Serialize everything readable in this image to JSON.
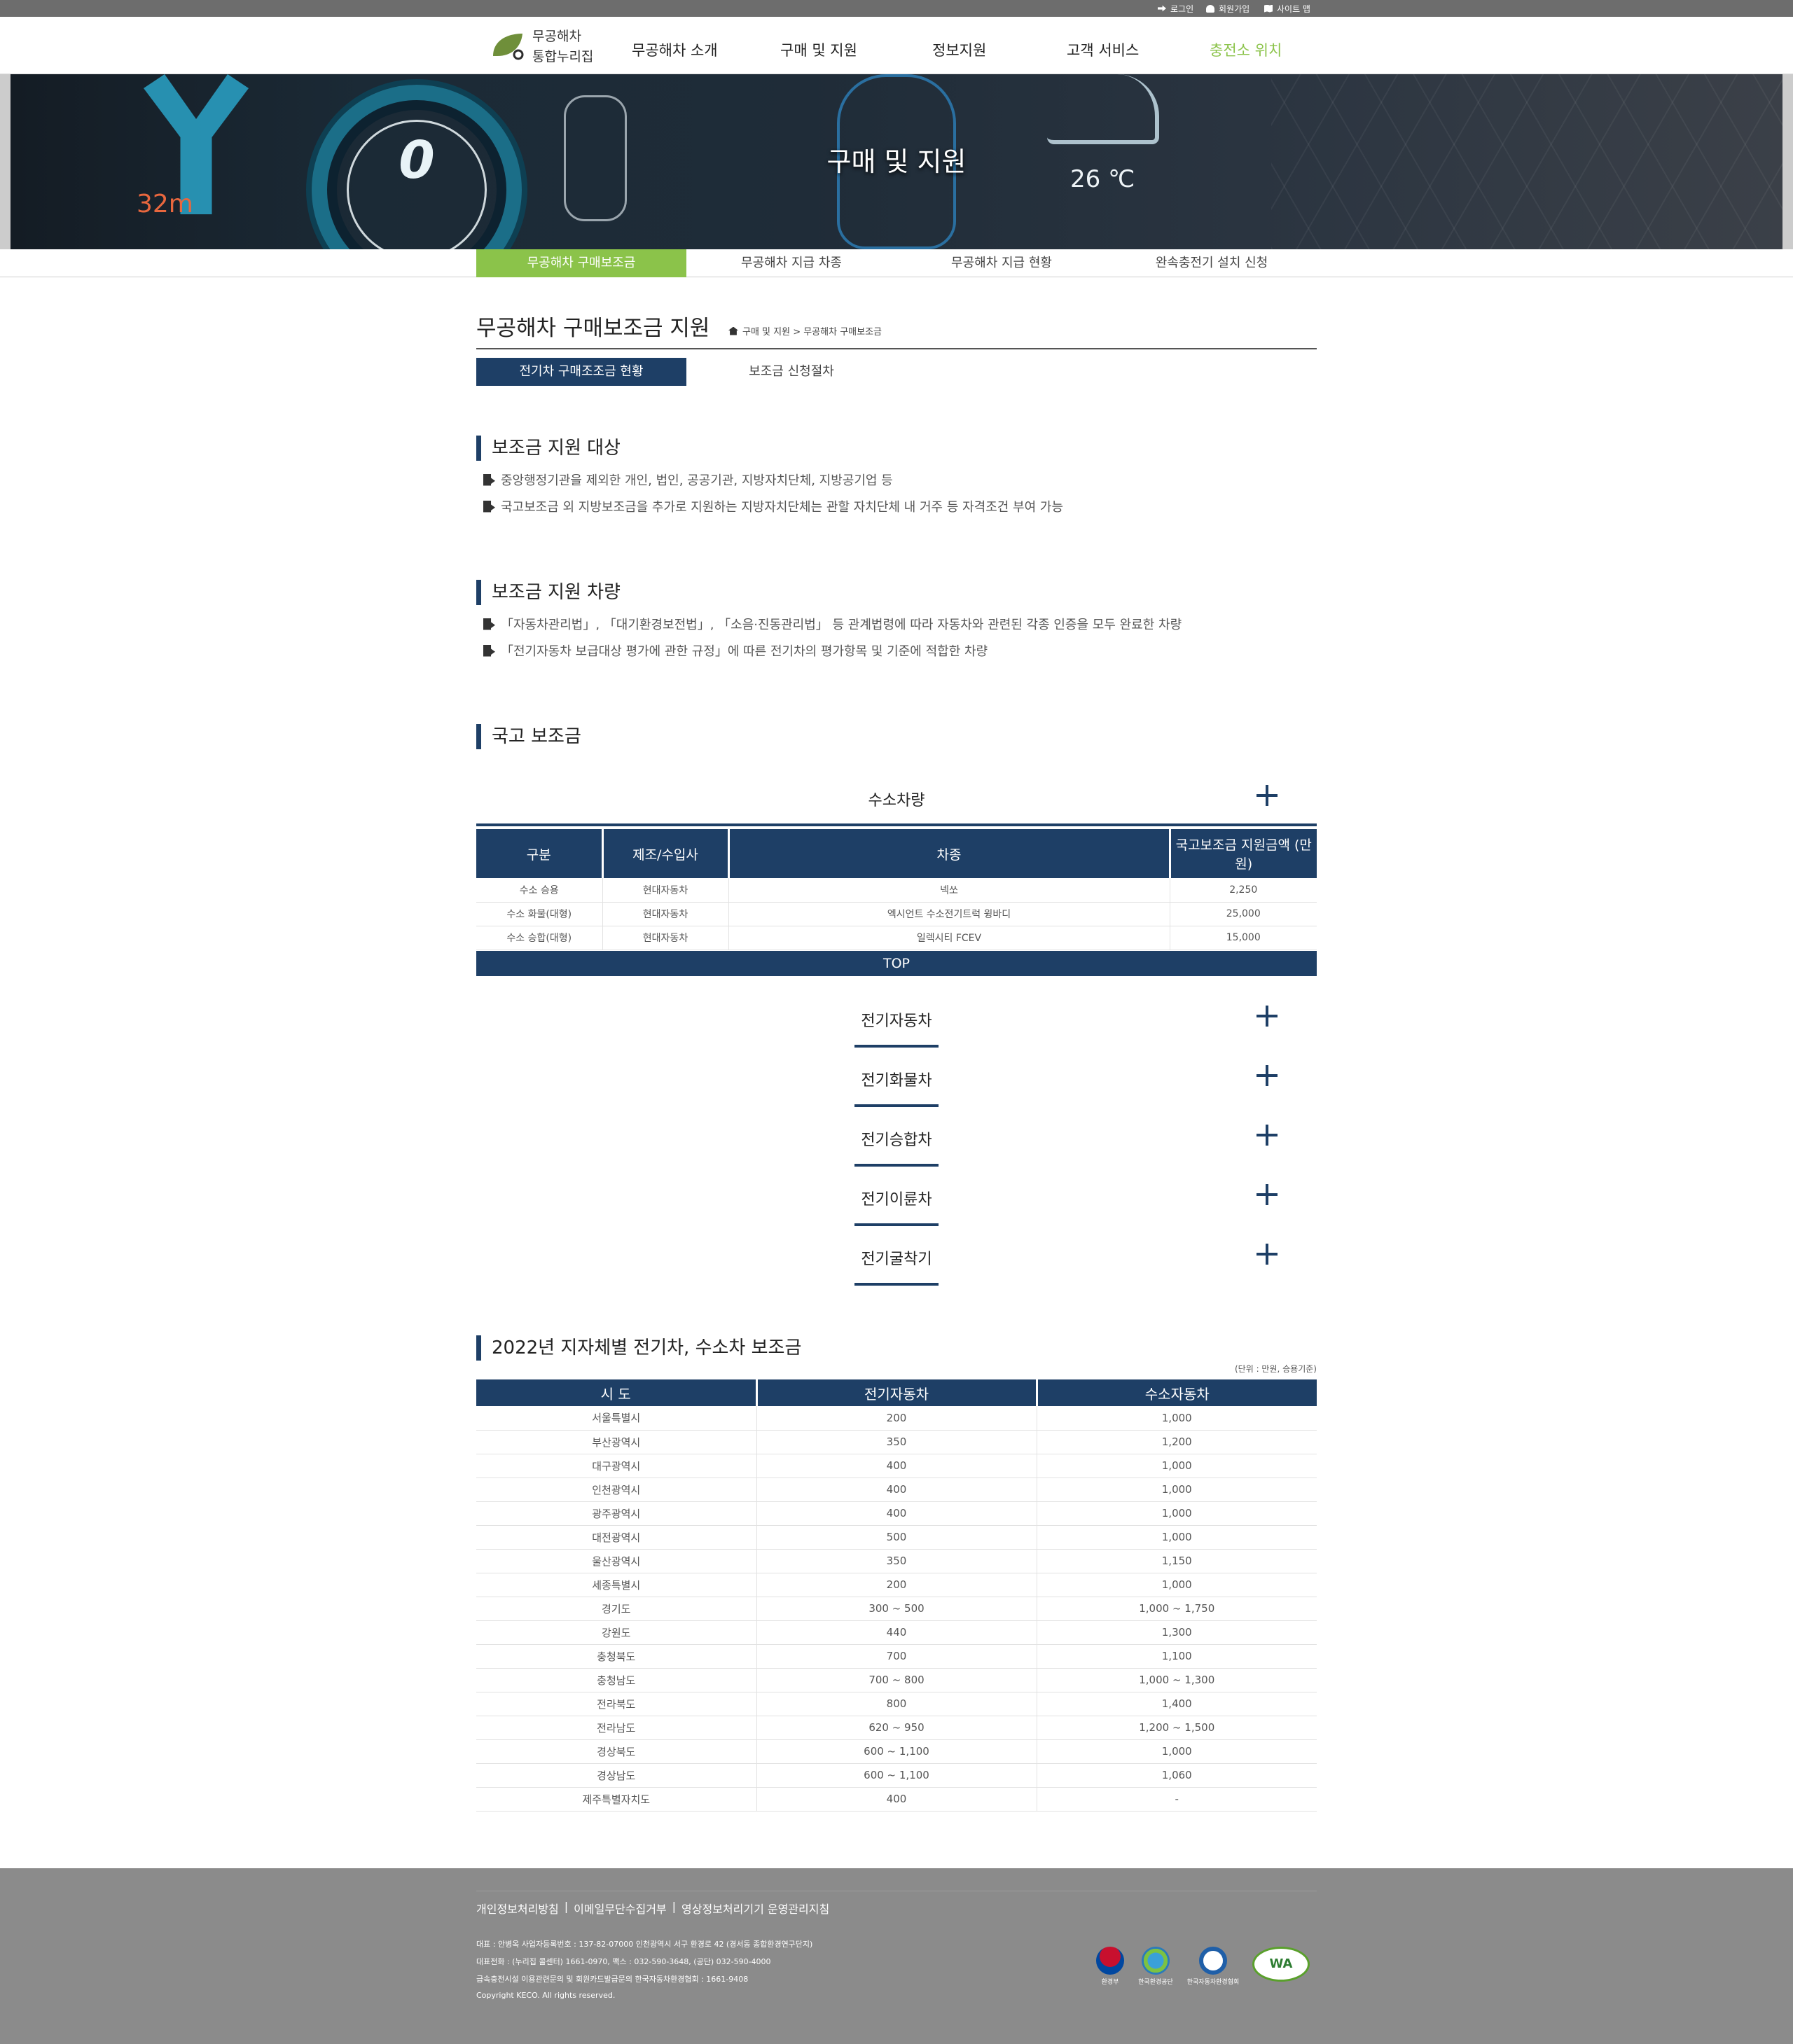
{
  "util": {
    "login": "로그인",
    "join": "회원가입",
    "sitemap": "사이트 맵"
  },
  "logo": {
    "line1": "무공해차",
    "line2": "통합누리집"
  },
  "gnb": [
    "무공해차 소개",
    "구매 및 지원",
    "정보지원",
    "고객 서비스",
    "충전소 위치"
  ],
  "banner": {
    "title": "구매 및 지원",
    "speed": "0",
    "distance": "32m",
    "temp": "26 ℃"
  },
  "subnav": [
    "무공해차 구매보조금",
    "무공해차 지급 차종",
    "무공해차 지급 현황",
    "완속충전기 설치 신청"
  ],
  "page": {
    "title": "무공해차 구매보조금 지원",
    "breadcrumb": "구매 및 지원 > 무공해차 구매보조금"
  },
  "tabs": [
    "전기차 구매조조금 현황",
    "보조금 신청절차"
  ],
  "section1": {
    "title": "보조금 지원 대상",
    "items": [
      "중앙행정기관을 제외한 개인, 법인, 공공기관, 지방자치단체, 지방공기업 등",
      "국고보조금 외 지방보조금을 추가로 지원하는 지방자치단체는 관할 자치단체 내 거주 등 자격조건 부여 가능"
    ]
  },
  "section2": {
    "title": "보조금 지원 차량",
    "items": [
      "「자동차관리법」, 「대기환경보전법」, 「소음·진동관리법」 등 관계법령에 따라 자동차와 관련된 각종 인증을 모두 완료한 차량",
      "「전기자동차 보급대상 평가에 관한 규정」에 따른 전기차의 평가항목 및 기준에 적합한 차량"
    ]
  },
  "section3": {
    "title": "국고 보조금",
    "accordion_open": "수소차량",
    "table": {
      "headers": [
        "구분",
        "제조/수입사",
        "차종",
        "국고보조금 지원금액 (만원)"
      ],
      "rows": [
        [
          "수소 승용",
          "현대자동차",
          "넥쏘",
          "2,250"
        ],
        [
          "수소 화물(대형)",
          "현대자동차",
          "엑시언트 수소전기트럭 윙바디",
          "25,000"
        ],
        [
          "수소 승합(대형)",
          "현대자동차",
          "일렉시티 FCEV",
          "15,000"
        ]
      ]
    },
    "top_label": "TOP",
    "accordions": [
      "전기자동차",
      "전기화물차",
      "전기승합차",
      "전기이륜차",
      "전기굴착기"
    ]
  },
  "section4": {
    "title": "2022년 지자체별 전기차, 수소차 보조금",
    "unit": "(단위 : 만원, 승용기준)",
    "headers": [
      "시 도",
      "전기자동차",
      "수소자동차"
    ],
    "rows": [
      [
        "서울특별시",
        "200",
        "1,000"
      ],
      [
        "부산광역시",
        "350",
        "1,200"
      ],
      [
        "대구광역시",
        "400",
        "1,000"
      ],
      [
        "인천광역시",
        "400",
        "1,000"
      ],
      [
        "광주광역시",
        "400",
        "1,000"
      ],
      [
        "대전광역시",
        "500",
        "1,000"
      ],
      [
        "울산광역시",
        "350",
        "1,150"
      ],
      [
        "세종특별시",
        "200",
        "1,000"
      ],
      [
        "경기도",
        "300 ~ 500",
        "1,000 ~ 1,750"
      ],
      [
        "강원도",
        "440",
        "1,300"
      ],
      [
        "충청북도",
        "700",
        "1,100"
      ],
      [
        "충청남도",
        "700 ~ 800",
        "1,000 ~ 1,300"
      ],
      [
        "전라북도",
        "800",
        "1,400"
      ],
      [
        "전라남도",
        "620 ~ 950",
        "1,200 ~ 1,500"
      ],
      [
        "경상북도",
        "600 ~ 1,100",
        "1,000"
      ],
      [
        "경상남도",
        "600 ~ 1,100",
        "1,060"
      ],
      [
        "제주특별자치도",
        "400",
        "-"
      ]
    ]
  },
  "footer": {
    "links": [
      "개인정보처리방침",
      "이메일무단수집거부",
      "영상정보처리기기 운영관리지침"
    ],
    "info": [
      "대표 : 안병옥 사업자등록번호 : 137-82-07000 인천광역시 서구 환경로 42 (경서동 종합환경연구단지)",
      "대표전화 : (누리집 콜센터) 1661-0970, 팩스 : 032-590-3648, (공단) 032-590-4000",
      "급속충전시설 이용관련문의 및 회원카드발급문의 한국자동차환경협회 : 1661-9408",
      "Copyright KECO. All rights reserved."
    ],
    "logos": [
      "환경부",
      "한국환경공단",
      "한국자동차환경협회",
      "WA"
    ]
  },
  "colors": {
    "navy": "#1e3f66",
    "green": "#8bc34a",
    "footer": "#8b8b8b"
  }
}
